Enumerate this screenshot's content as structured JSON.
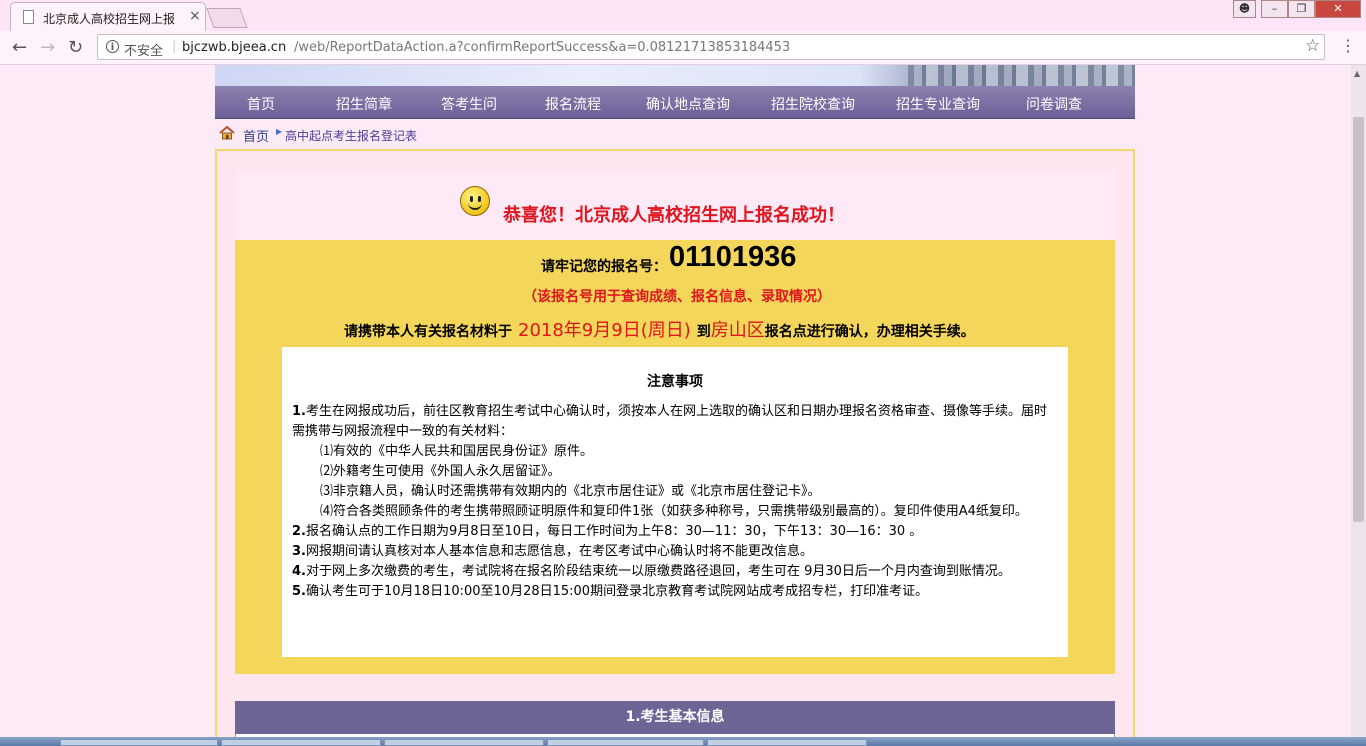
{
  "browser": {
    "tab_title": "北京成人高校招生网上报",
    "security_label": "不安全",
    "url_host": "bjczwb.bjeea.cn",
    "url_path": "/web/ReportDataAction.a?confirmReportSuccess&a=0.08121713853184453"
  },
  "nav": {
    "items": [
      "首页",
      "招生简章",
      "答考生问",
      "报名流程",
      "确认地点查询",
      "招生院校查询",
      "招生专业查询",
      "问卷调查"
    ]
  },
  "breadcrumb": {
    "home": "首页",
    "current": "高中起点考生报名登记表"
  },
  "success": {
    "message": "恭喜您！北京成人高校招生网上报名成功！"
  },
  "registration": {
    "label": "请牢记您的报名号：",
    "number": "01101936",
    "note": "（该报名号用于查询成绩、报名信息、录取情况）",
    "confirm_prefix": "请携带本人有关报名材料于",
    "confirm_date": "2018年9月9日(周日)",
    "confirm_to": "到",
    "confirm_district": "房山区",
    "confirm_suffix": "报名点进行确认，办理相关手续。"
  },
  "notice": {
    "title": "注意事项",
    "p1_num": "1.",
    "p1": "考生在网报成功后，前往区教育招生考试中心确认时，须按本人在网上选取的确认区和日期办理报名资格审查、摄像等手续。届时需携带与网报流程中一致的有关材料：",
    "p1_a": "⑴有效的《中华人民共和国居民身份证》原件。",
    "p1_b": "⑵外籍考生可使用《外国人永久居留证》。",
    "p1_c": "⑶非京籍人员，确认时还需携带有效期内的《北京市居住证》或《北京市居住登记卡》。",
    "p1_d": "⑷符合各类照顾条件的考生携带照顾证明原件和复印件1张（如获多种称号，只需携带级别最高的）。复印件使用A4纸复印。",
    "p2_num": "2.",
    "p2": "报名确认点的工作日期为9月8日至10日，每日工作时间为上午8：30—11：30，下午13：30—16：30 。",
    "p3_num": "3.",
    "p3": "网报期间请认真核对本人基本信息和志愿信息，在考区考试中心确认时将不能更改信息。",
    "p4_num": "4.",
    "p4": "对于网上多次缴费的考生，考试院将在报名阶段结束统一以原缴费路径退回，考生可在 9月30日后一个月内查询到账情况。",
    "p5_num": "5.",
    "p5": "确认考生可于10月18日10:00至10月28日15:00期间登录北京教育考试院网站成考成招专栏，打印准考证。"
  },
  "section": {
    "title": "1.考生基本信息"
  },
  "colors": {
    "nav_bg": "#6b5f97",
    "panel_yellow": "#f4d65a",
    "accent_red": "#e0151e",
    "section_bg": "#6d6596"
  }
}
